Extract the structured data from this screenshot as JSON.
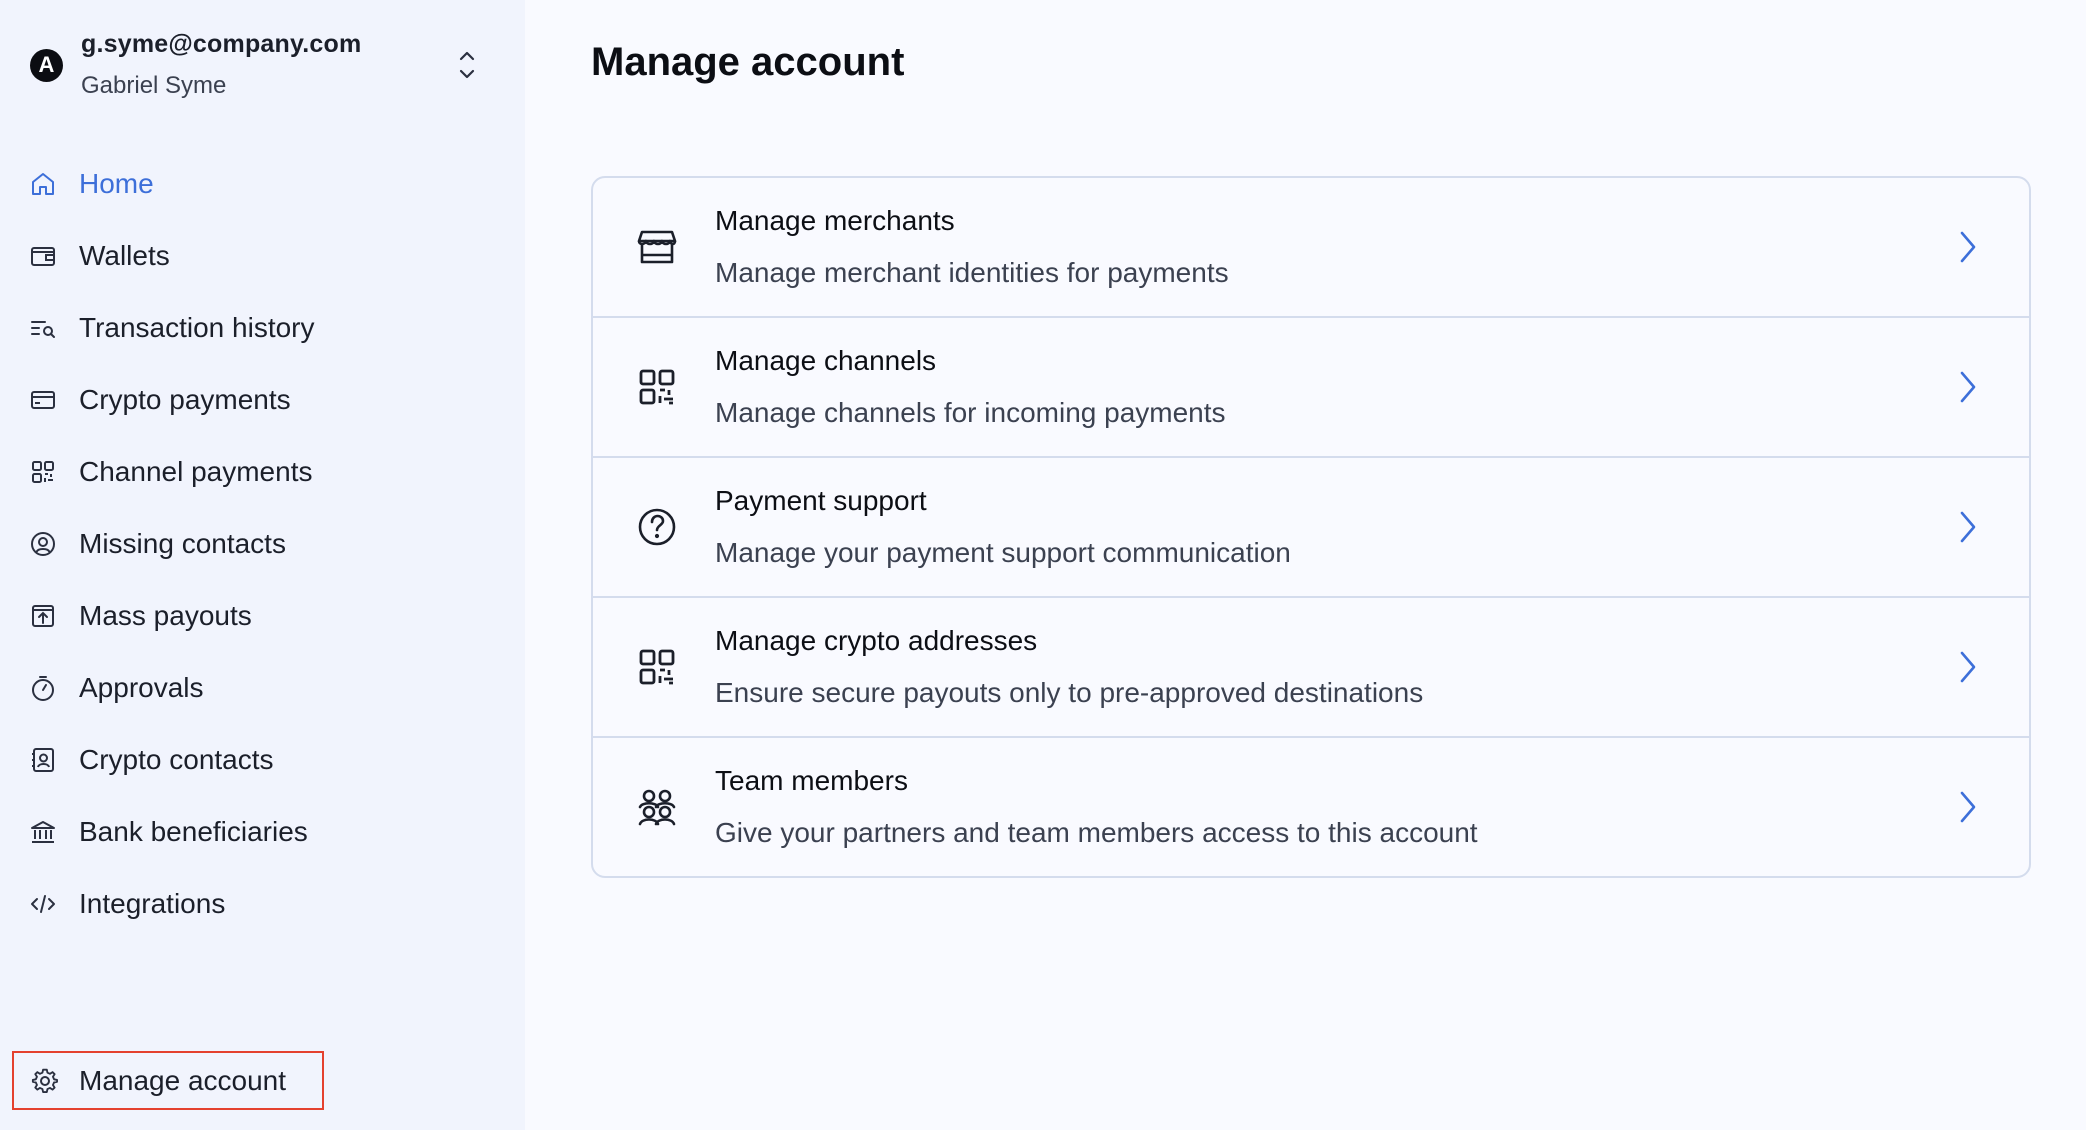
{
  "account": {
    "avatar_letter": "A",
    "email": "g.syme@company.com",
    "name": "Gabriel Syme"
  },
  "sidebar": {
    "items": [
      {
        "label": "Home",
        "icon": "home-icon",
        "active": true
      },
      {
        "label": "Wallets",
        "icon": "wallet-icon"
      },
      {
        "label": "Transaction history",
        "icon": "transaction-search-icon"
      },
      {
        "label": "Crypto payments",
        "icon": "card-icon"
      },
      {
        "label": "Channel payments",
        "icon": "qr-code-icon"
      },
      {
        "label": "Missing contacts",
        "icon": "user-circle-icon"
      },
      {
        "label": "Mass payouts",
        "icon": "upload-box-icon"
      },
      {
        "label": "Approvals",
        "icon": "stopwatch-icon"
      },
      {
        "label": "Crypto contacts",
        "icon": "contact-book-icon"
      },
      {
        "label": "Bank beneficiaries",
        "icon": "bank-icon"
      },
      {
        "label": "Integrations",
        "icon": "code-icon"
      }
    ],
    "manage_account_label": "Manage account"
  },
  "main": {
    "title": "Manage account",
    "rows": [
      {
        "title": "Manage merchants",
        "subtitle": "Manage merchant identities for payments",
        "icon": "storefront-icon"
      },
      {
        "title": "Manage channels",
        "subtitle": "Manage channels for incoming payments",
        "icon": "qr-code-icon"
      },
      {
        "title": "Payment support",
        "subtitle": "Manage your payment support communication",
        "icon": "question-circle-icon"
      },
      {
        "title": "Manage crypto addresses",
        "subtitle": "Ensure secure payouts only to pre-approved destinations",
        "icon": "qr-code-icon"
      },
      {
        "title": "Team members",
        "subtitle": "Give your partners and team members access to this account",
        "icon": "team-icon"
      }
    ]
  },
  "colors": {
    "accent": "#3d6fd9",
    "highlight_border": "#e4412e",
    "sidebar_bg": "#f1f4fd",
    "main_bg": "#f9faff"
  }
}
